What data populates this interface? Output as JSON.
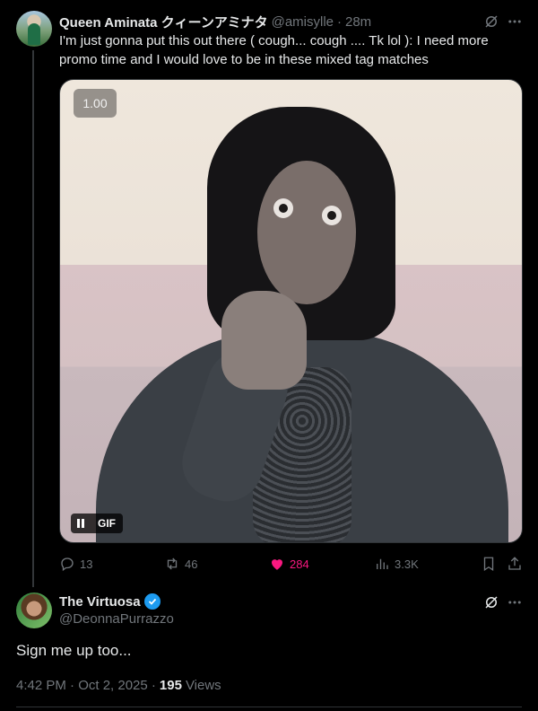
{
  "reply_tweet": {
    "author_name": "Queen Aminata クィーンアミナタ",
    "handle": "@amisylle",
    "separator": "·",
    "time": "28m",
    "text": "I'm just gonna put this out there ( cough... cough .... Tk lol ): I need more promo time and I would love to be in these mixed tag matches",
    "media": {
      "speed_label": "1.00",
      "gif_label": "GIF"
    },
    "actions": {
      "replies": "13",
      "reposts": "46",
      "likes": "284",
      "views": "3.3K"
    }
  },
  "main_tweet": {
    "author_name": "The Virtuosa",
    "handle": "@DeonnaPurrazzo",
    "text": "Sign me up too...",
    "timestamp": "4:42 PM · Oct 2, 2025 ·",
    "views_count": "195",
    "views_label": "Views"
  },
  "colors": {
    "background": "#000000",
    "text_primary": "#e7e9ea",
    "text_secondary": "#71767b",
    "like_pink": "#f91880",
    "verified_blue": "#1d9bf0"
  }
}
